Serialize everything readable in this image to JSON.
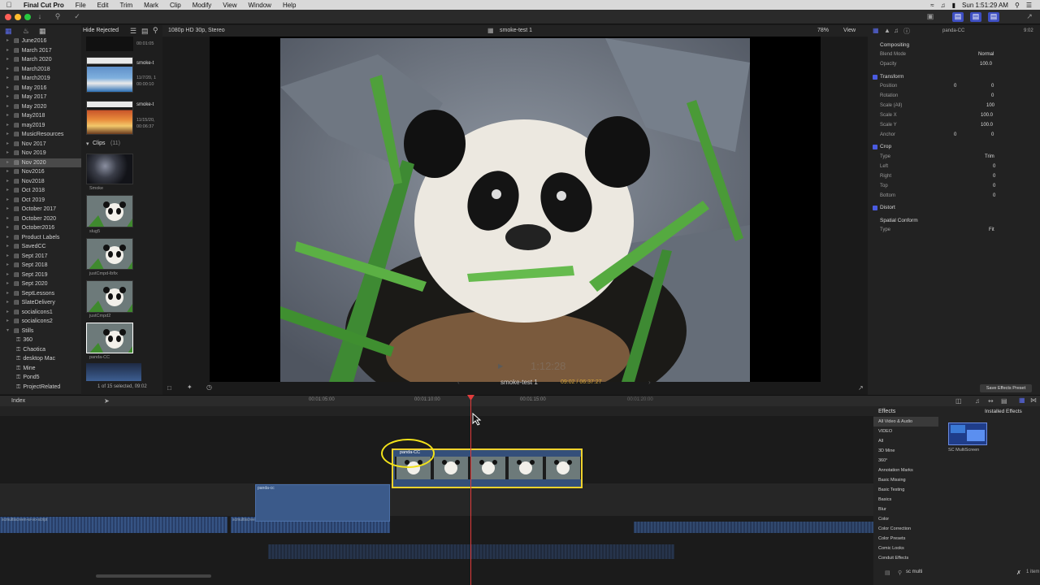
{
  "menubar": {
    "app": "Final Cut Pro",
    "items": [
      "File",
      "Edit",
      "Trim",
      "Mark",
      "Clip",
      "Modify",
      "View",
      "Window",
      "Help"
    ],
    "clock": "Sun 1:51:29 AM"
  },
  "browser_header": {
    "filter": "Hide Rejected",
    "format": "1080p HD 30p, Stereo"
  },
  "library": {
    "items": [
      {
        "label": "June2016"
      },
      {
        "label": "March 2017"
      },
      {
        "label": "March 2020"
      },
      {
        "label": "March2018"
      },
      {
        "label": "March2019"
      },
      {
        "label": "May 2016"
      },
      {
        "label": "May 2017"
      },
      {
        "label": "May 2020"
      },
      {
        "label": "May2018"
      },
      {
        "label": "may2019"
      },
      {
        "label": "MusicResources"
      },
      {
        "label": "Nov 2017"
      },
      {
        "label": "Nov 2019"
      },
      {
        "label": "Nov 2020",
        "selected": true
      },
      {
        "label": "Nov2016"
      },
      {
        "label": "Nov2018"
      },
      {
        "label": "Oct 2018"
      },
      {
        "label": "Oct 2019"
      },
      {
        "label": "October 2017"
      },
      {
        "label": "October 2020"
      },
      {
        "label": "October2016"
      },
      {
        "label": "Product Labels"
      },
      {
        "label": "SavedCC"
      },
      {
        "label": "Sept 2017"
      },
      {
        "label": "Sept 2018"
      },
      {
        "label": "Sept 2019"
      },
      {
        "label": "Sept 2020"
      },
      {
        "label": "SeptLessons"
      },
      {
        "label": "SlateDelivery"
      },
      {
        "label": "socialicons1"
      },
      {
        "label": "socialicons2"
      },
      {
        "label": "Stills",
        "expanded": true
      }
    ],
    "children": [
      "360",
      "Chaotica",
      "desktop Mac",
      "Mine",
      "Pond5",
      "ProjectRelated"
    ]
  },
  "browser": {
    "projects": [
      {
        "name": "smoke-t",
        "date": "11/7/20, 1",
        "dur": "00:00:10"
      },
      {
        "name": "smoke-t",
        "date": "11/15/20,",
        "dur": "00:06:37"
      }
    ],
    "top_dur": "00:01:05",
    "clips_label": "Clips",
    "clips_count": "(11)",
    "clips": [
      {
        "name": "Smoke"
      },
      {
        "name": "slug5"
      },
      {
        "name": "justCmpd-lbfix"
      },
      {
        "name": "justCmpd2"
      },
      {
        "name": "panda-CC",
        "selected": true
      }
    ],
    "selection_status": "1 of 15 selected, 09:02"
  },
  "viewer": {
    "project": "smoke-test 1",
    "zoom": "78%",
    "view_menu": "View",
    "timecode_overlay": "1:12:28",
    "project_title": "smoke-test 1",
    "position": "09:02 / 06:37:27"
  },
  "inspector": {
    "clip_name": "panda-CC",
    "duration": "9:02",
    "compositing": "Compositing",
    "blend_mode_label": "Blend Mode",
    "blend_mode": "Normal",
    "opacity_label": "Opacity",
    "opacity": "100.0",
    "transform": "Transform",
    "position_label": "Position",
    "position_x": "0",
    "position_y": "0",
    "rotation_label": "Rotation",
    "rotation": "0",
    "scale_all_label": "Scale (All)",
    "scale_all": "100",
    "scale_x_label": "Scale X",
    "scale_x": "100.0",
    "scale_y_label": "Scale Y",
    "scale_y": "100.0",
    "anchor_label": "Anchor",
    "anchor_x": "0",
    "anchor_y": "0",
    "crop": "Crop",
    "crop_type_label": "Type",
    "crop_type": "Trim",
    "left_label": "Left",
    "left": "0",
    "right_label": "Right",
    "right": "0",
    "top_label": "Top",
    "top": "0",
    "bottom_label": "Bottom",
    "bottom": "0",
    "distort": "Distort",
    "spatial": "Spatial Conform",
    "sc_type_label": "Type",
    "sc_type": "Fit",
    "save_preset": "Save Effects Preset"
  },
  "timeline": {
    "index": "Index",
    "ruler_main": [
      "00:01:05:00",
      "00:01:10:00",
      "00:01:15:00",
      "00:01:20:00"
    ],
    "clip_selected": "panda-CC",
    "clip_lower": "panda-cc",
    "audio_a": "scmultiscreen-w-vo-script",
    "audio_b": "scmultiscreen-w-vo-script"
  },
  "effects": {
    "title": "Effects",
    "installed": "Installed Effects",
    "categories": [
      "All Video & Audio",
      "VIDEO",
      "All",
      "3D Mine",
      "360°",
      "Annotation Marks",
      "Basic Missing",
      "Basic Testing",
      "Basics",
      "Blur",
      "Color",
      "Color Correction",
      "Color Presets",
      "Comic Looks",
      "Conduit Effects"
    ],
    "result": "SC MultiScreen",
    "search": "sc multi",
    "count": "1 item"
  }
}
